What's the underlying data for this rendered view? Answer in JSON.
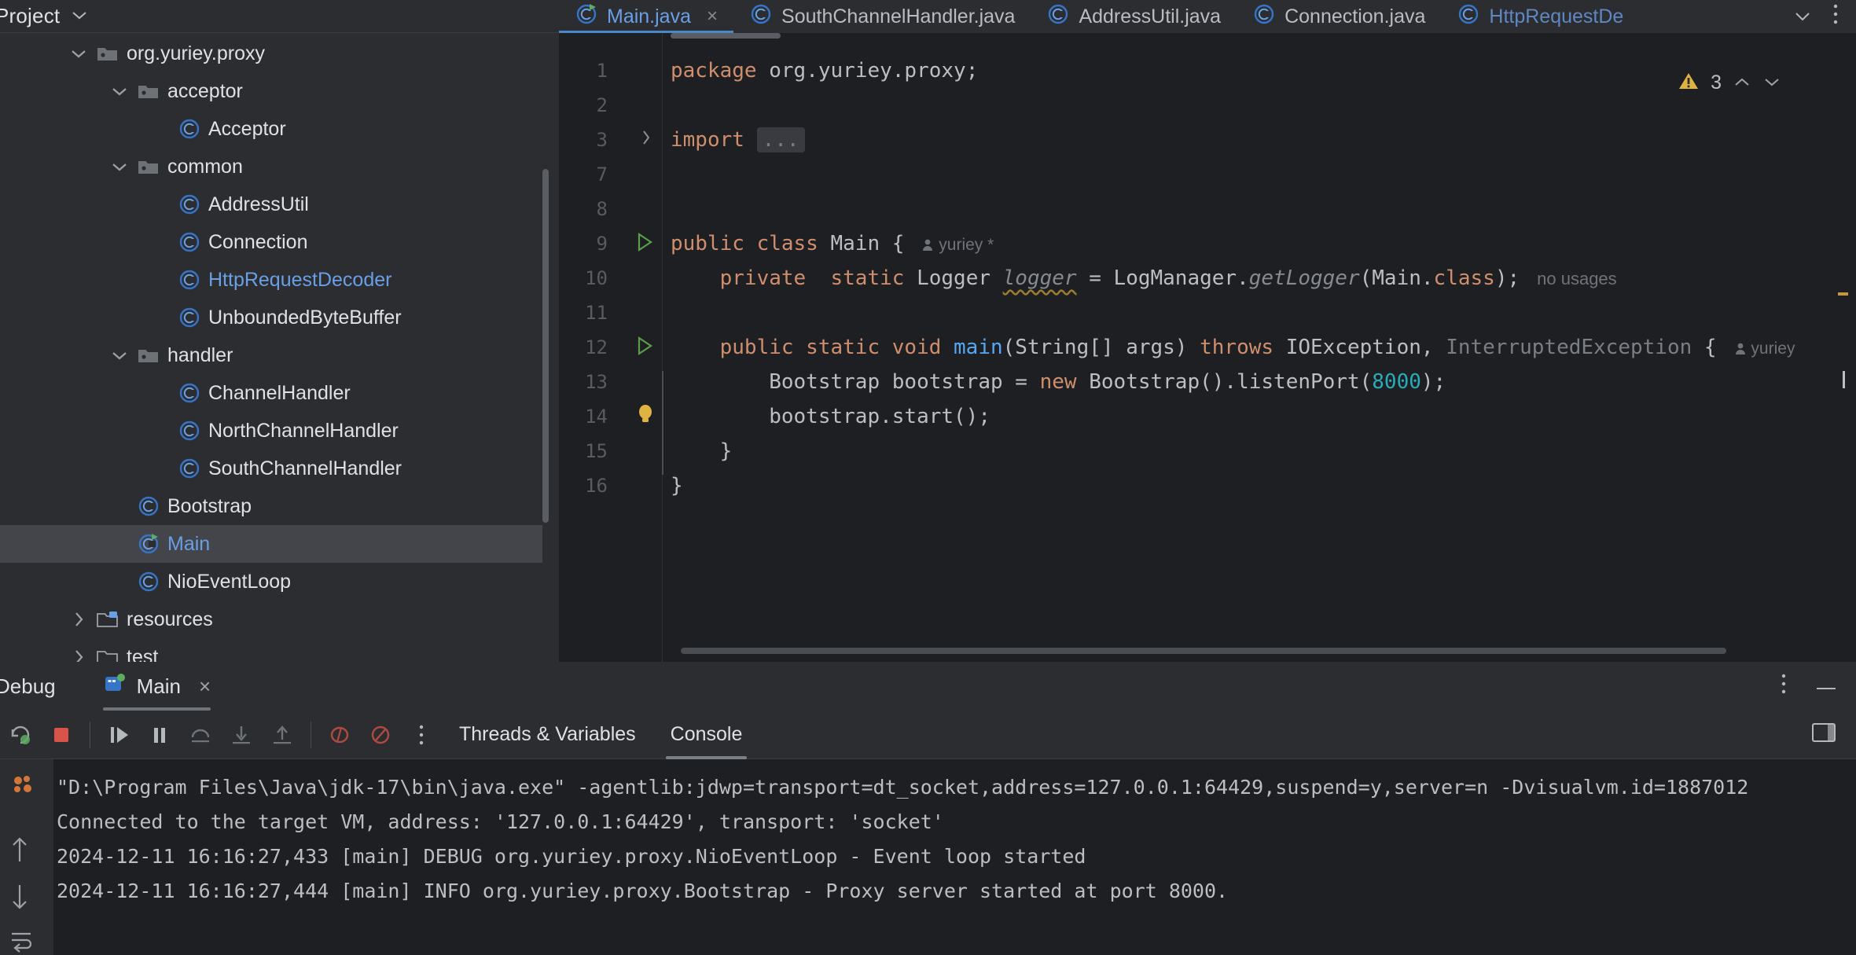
{
  "project": {
    "title": "Project",
    "chevron_icon": "chevron-down-icon",
    "tree": [
      {
        "label": "org.yuriey.proxy",
        "icon": "package-icon",
        "indent": 1,
        "expanded": true,
        "twisty": true,
        "selected": false,
        "blue": false
      },
      {
        "label": "acceptor",
        "icon": "package-icon",
        "indent": 2,
        "expanded": true,
        "twisty": true,
        "selected": false,
        "blue": false
      },
      {
        "label": "Acceptor",
        "icon": "class-icon",
        "indent": 3,
        "expanded": false,
        "twisty": false,
        "selected": false,
        "blue": false
      },
      {
        "label": "common",
        "icon": "package-icon",
        "indent": 2,
        "expanded": true,
        "twisty": true,
        "selected": false,
        "blue": false
      },
      {
        "label": "AddressUtil",
        "icon": "class-icon",
        "indent": 3,
        "expanded": false,
        "twisty": false,
        "selected": false,
        "blue": false
      },
      {
        "label": "Connection",
        "icon": "class-icon",
        "indent": 3,
        "expanded": false,
        "twisty": false,
        "selected": false,
        "blue": false
      },
      {
        "label": "HttpRequestDecoder",
        "icon": "class-icon",
        "indent": 3,
        "expanded": false,
        "twisty": false,
        "selected": false,
        "blue": true
      },
      {
        "label": "UnboundedByteBuffer",
        "icon": "class-icon",
        "indent": 3,
        "expanded": false,
        "twisty": false,
        "selected": false,
        "blue": false
      },
      {
        "label": "handler",
        "icon": "package-icon",
        "indent": 2,
        "expanded": true,
        "twisty": true,
        "selected": false,
        "blue": false
      },
      {
        "label": "ChannelHandler",
        "icon": "class-icon",
        "indent": 3,
        "expanded": false,
        "twisty": false,
        "selected": false,
        "blue": false
      },
      {
        "label": "NorthChannelHandler",
        "icon": "class-icon",
        "indent": 3,
        "expanded": false,
        "twisty": false,
        "selected": false,
        "blue": false
      },
      {
        "label": "SouthChannelHandler",
        "icon": "class-icon",
        "indent": 3,
        "expanded": false,
        "twisty": false,
        "selected": false,
        "blue": false
      },
      {
        "label": "Bootstrap",
        "icon": "class-icon",
        "indent": 2,
        "expanded": false,
        "twisty": false,
        "selected": false,
        "blue": false
      },
      {
        "label": "Main",
        "icon": "runnable-class-icon",
        "indent": 2,
        "expanded": false,
        "twisty": false,
        "selected": true,
        "blue": true
      },
      {
        "label": "NioEventLoop",
        "icon": "class-icon",
        "indent": 2,
        "expanded": false,
        "twisty": false,
        "selected": false,
        "blue": false
      },
      {
        "label": "resources",
        "icon": "resource-folder-icon",
        "indent": 1,
        "expanded": false,
        "twisty": true,
        "selected": false,
        "blue": false
      },
      {
        "label": "test",
        "icon": "folder-icon",
        "indent": 1,
        "expanded": false,
        "twisty": true,
        "selected": false,
        "blue": false
      }
    ]
  },
  "editor": {
    "tabs": [
      {
        "label": "Main.java",
        "active": true,
        "closable": true
      },
      {
        "label": "SouthChannelHandler.java",
        "active": false,
        "closable": false
      },
      {
        "label": "AddressUtil.java",
        "active": false,
        "closable": false
      },
      {
        "label": "Connection.java",
        "active": false,
        "closable": false
      },
      {
        "label": "HttpRequestDe",
        "active": false,
        "closable": false,
        "faded": true
      }
    ],
    "tab_overflow_icon": "chevron-down-icon",
    "tab_more_icon": "more-vertical-icon",
    "warnings": {
      "count": "3",
      "icon": "warning-triangle-icon",
      "up_icon": "chevron-up-icon",
      "down_icon": "chevron-down-icon"
    },
    "line_numbers": [
      "1",
      "2",
      "3",
      "7",
      "8",
      "9",
      "10",
      "11",
      "12",
      "13",
      "14",
      "15",
      "16"
    ],
    "code_lines": [
      {
        "num": "1",
        "segments": [
          {
            "t": "package ",
            "c": "k"
          },
          {
            "t": "org.yuriey.proxy;",
            "c": "t"
          }
        ]
      },
      {
        "num": "2",
        "segments": []
      },
      {
        "num": "3",
        "segments": [
          {
            "t": "import ",
            "c": "k"
          },
          {
            "t": "...",
            "c": "import-dots"
          }
        ],
        "fold": true
      },
      {
        "num": "7",
        "segments": []
      },
      {
        "num": "8",
        "segments": []
      },
      {
        "num": "9",
        "segments": [
          {
            "t": "public class ",
            "c": "k"
          },
          {
            "t": "Main {",
            "c": "t"
          }
        ],
        "gutter_icon": "run-gutter-icon",
        "author": "yuriey *"
      },
      {
        "num": "10",
        "segments": [
          {
            "t": "    private  static ",
            "c": "k"
          },
          {
            "t": "Logger ",
            "c": "t"
          },
          {
            "t": "logger",
            "c": "ital-warn"
          },
          {
            "t": " = LogManager.",
            "c": "t"
          },
          {
            "t": "getLogger",
            "c": "ital"
          },
          {
            "t": "(Main.",
            "c": "t"
          },
          {
            "t": "class",
            "c": "k"
          },
          {
            "t": ");",
            "c": "t"
          }
        ],
        "hint": "no usages"
      },
      {
        "num": "11",
        "segments": []
      },
      {
        "num": "12",
        "segments": [
          {
            "t": "    public static void ",
            "c": "k"
          },
          {
            "t": "main",
            "c": "m"
          },
          {
            "t": "(String[] args) ",
            "c": "t"
          },
          {
            "t": "throws ",
            "c": "k"
          },
          {
            "t": "IOException, ",
            "c": "t"
          },
          {
            "t": "InterruptedException",
            "c": "dim"
          },
          {
            "t": " {",
            "c": "t"
          }
        ],
        "gutter_icon": "run-gutter-icon",
        "author": "yuriey"
      },
      {
        "num": "13",
        "segments": [
          {
            "t": "        Bootstrap bootstrap = ",
            "c": "t"
          },
          {
            "t": "new ",
            "c": "k"
          },
          {
            "t": "Bootstrap().listenPort(",
            "c": "t"
          },
          {
            "t": "8000",
            "c": "num"
          },
          {
            "t": ");",
            "c": "t"
          }
        ]
      },
      {
        "num": "14",
        "segments": [
          {
            "t": "        bootstrap.start();",
            "c": "t"
          }
        ],
        "gutter_icon": "bulb-icon",
        "current": true
      },
      {
        "num": "15",
        "segments": [
          {
            "t": "    }",
            "c": "t"
          }
        ]
      },
      {
        "num": "16",
        "segments": [
          {
            "t": "}",
            "c": "t"
          }
        ]
      }
    ]
  },
  "debug": {
    "title": "Debug",
    "session_tab": "Main",
    "session_icon": "debug-session-icon",
    "close_icon": "close-icon",
    "more_icon": "more-vertical-icon",
    "minimize_icon": "minimize-icon",
    "layout_icon": "layout-settings-icon",
    "toolbar_icons": [
      "rerun-debug-icon",
      "stop-icon",
      "resume-icon",
      "pause-icon",
      "step-over-icon",
      "step-into-icon",
      "step-out-icon",
      "evaluate-icon",
      "mute-breakpoints-icon",
      "more-vertical-icon"
    ],
    "tabs": [
      {
        "label": "Threads & Variables",
        "active": false
      },
      {
        "label": "Console",
        "active": true
      }
    ],
    "side_icons": [
      "scroll-to-end-icon",
      "up-icon",
      "down-icon",
      "soft-wrap-icon"
    ],
    "console_lines": [
      "\"D:\\Program Files\\Java\\jdk-17\\bin\\java.exe\" -agentlib:jdwp=transport=dt_socket,address=127.0.0.1:64429,suspend=y,server=n -Dvisualvm.id=1887012",
      "Connected to the target VM, address: '127.0.0.1:64429', transport: 'socket'",
      "2024-12-11 16:16:27,433 [main] DEBUG org.yuriey.proxy.NioEventLoop - Event loop started",
      "2024-12-11 16:16:27,444 [main] INFO org.yuriey.proxy.Bootstrap - Proxy server started at port 8000."
    ]
  },
  "colors": {
    "bg": "#2b2d30",
    "editor_bg": "#1e1f22",
    "selection": "#43454a",
    "accent_blue": "#6a9fe6",
    "keyword_orange": "#cf8e6d",
    "number_teal": "#2aacb8",
    "method_blue": "#56a8f5",
    "warning_yellow": "#e0b341",
    "run_green": "#5a9e4b"
  }
}
